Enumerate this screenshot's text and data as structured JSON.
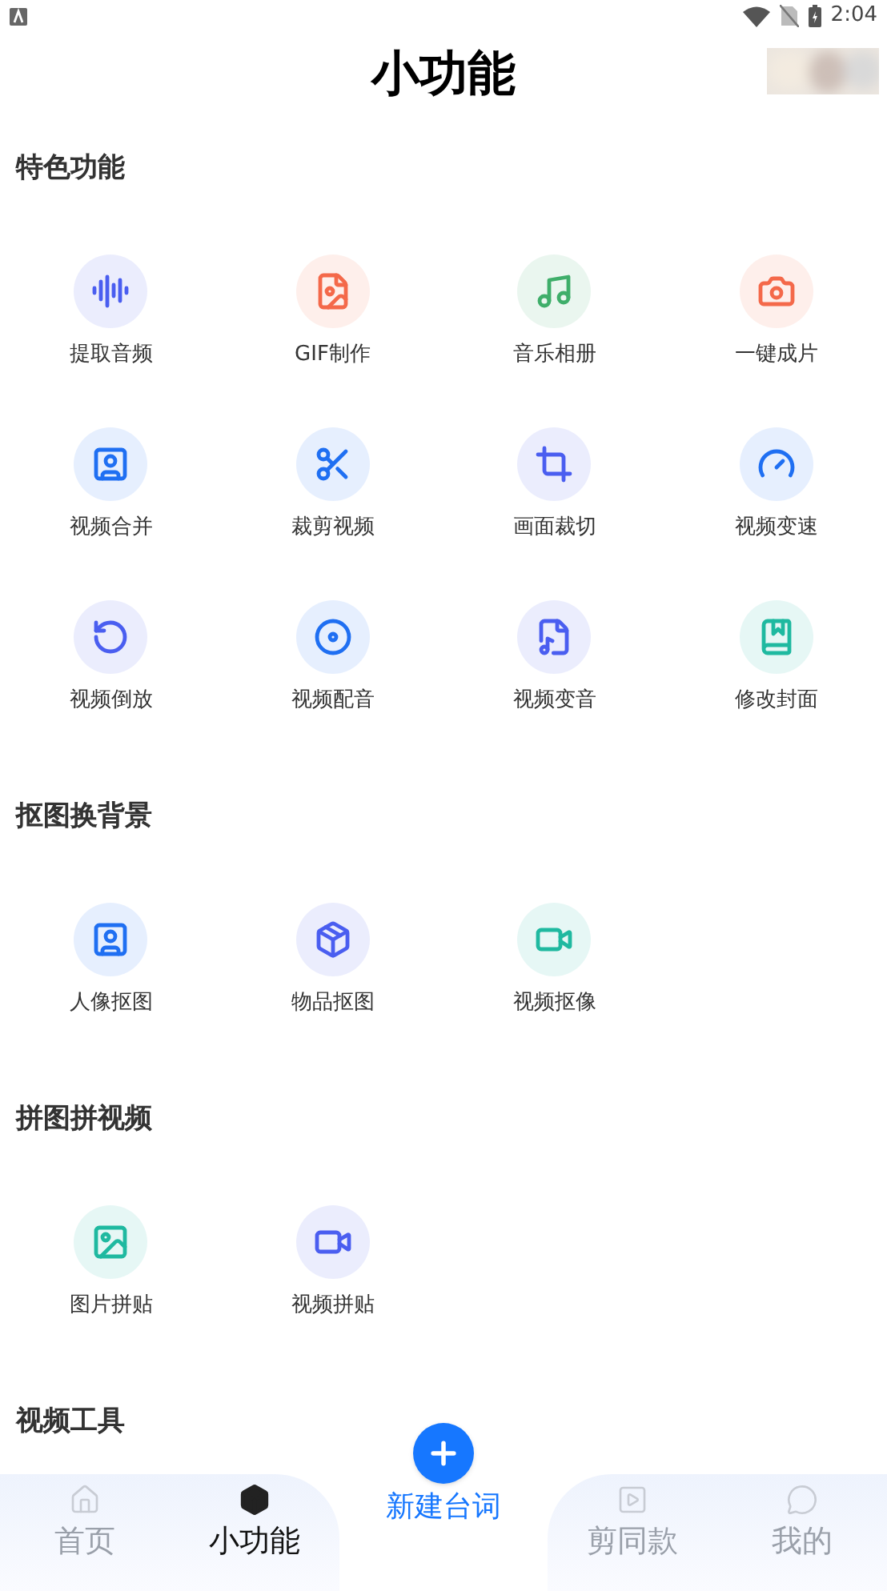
{
  "status_bar": {
    "time": "2:04"
  },
  "header": {
    "title": "小功能"
  },
  "sections": [
    {
      "title": "特色功能",
      "items": [
        {
          "label": "提取音频",
          "color": "#4a5ef0"
        },
        {
          "label": "GIF制作",
          "color": "#f4694a"
        },
        {
          "label": "音乐相册",
          "color": "#3fae6a"
        },
        {
          "label": "一键成片",
          "color": "#f4694a"
        },
        {
          "label": "视频合并",
          "color": "#1f6ff2"
        },
        {
          "label": "裁剪视频",
          "color": "#1f6ff2"
        },
        {
          "label": "画面裁切",
          "color": "#4a5ef0"
        },
        {
          "label": "视频变速",
          "color": "#1f6ff2"
        },
        {
          "label": "视频倒放",
          "color": "#4a5ef0"
        },
        {
          "label": "视频配音",
          "color": "#1f6ff2"
        },
        {
          "label": "视频变音",
          "color": "#4a5ef0"
        },
        {
          "label": "修改封面",
          "color": "#1fb9a0"
        }
      ]
    },
    {
      "title": "抠图换背景",
      "items": [
        {
          "label": "人像抠图",
          "color": "#1f6ff2"
        },
        {
          "label": "物品抠图",
          "color": "#4a5ef0"
        },
        {
          "label": "视频抠像",
          "color": "#1fb9a0"
        }
      ]
    },
    {
      "title": "拼图拼视频",
      "items": [
        {
          "label": "图片拼贴",
          "color": "#1fb9a0"
        },
        {
          "label": "视频拼贴",
          "color": "#4a5ef0"
        }
      ]
    },
    {
      "title": "视频工具"
    }
  ],
  "bottom_nav": [
    {
      "kind": "tab",
      "label": "首页",
      "selected": false
    },
    {
      "kind": "tab",
      "label": "小功能",
      "selected": true
    },
    {
      "kind": "create",
      "label": "新建台词"
    },
    {
      "kind": "tab",
      "label": "剪同款",
      "selected": false
    },
    {
      "kind": "tab",
      "label": "我的",
      "selected": false
    }
  ]
}
